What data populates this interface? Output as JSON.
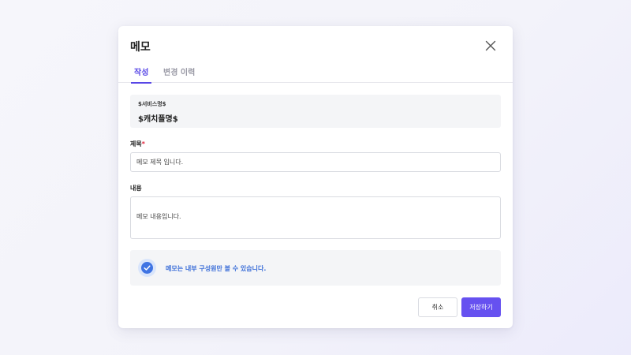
{
  "modal": {
    "title": "메모",
    "tabs": [
      {
        "label": "작성",
        "active": true
      },
      {
        "label": "변경 이력",
        "active": false
      }
    ],
    "service": {
      "label": "$서비스명$",
      "value": "$캐치플명$"
    },
    "title_field": {
      "label": "제목",
      "required_mark": "*",
      "value": "메모 제목 입니다."
    },
    "content_field": {
      "label": "내용",
      "value": "메모 내용입니다."
    },
    "notice": {
      "text": "메모는 내부 구성원만 볼 수 있습니다.",
      "icon": "check-circle-icon"
    },
    "buttons": {
      "cancel": "취소",
      "save": "저장하기"
    }
  },
  "colors": {
    "accent": "#5847e6",
    "primary_button": "#6651f0",
    "notice_text": "#3b6ed8",
    "check_icon": "#3f74e3",
    "required": "#e0223a",
    "panel_bg": "#f4f5f7"
  }
}
